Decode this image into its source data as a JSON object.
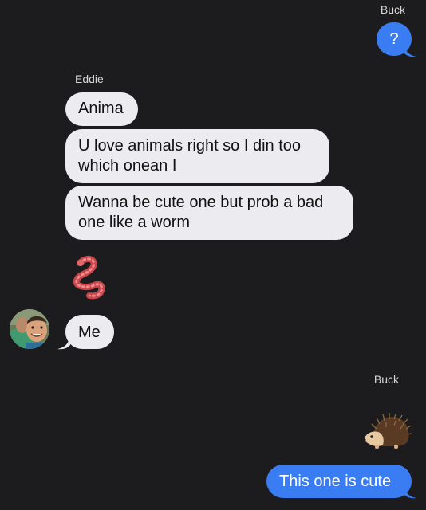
{
  "conversation": {
    "buck_label_top": "Buck",
    "buck_msg_1": "?",
    "eddie_label": "Eddie",
    "eddie_msg_1": "Anima",
    "eddie_msg_2_line_1": "U love animals right so I din too",
    "eddie_msg_2_line_2": "which onean I",
    "eddie_msg_3_line_1": "Wanna be cute one but prob a bad",
    "eddie_msg_3_line_2": "one like a worm",
    "eddie_emoji": "worm",
    "eddie_msg_4": "Me",
    "buck_label_bottom": "Buck",
    "buck_emoji": "hedgehog",
    "buck_msg_2": "This one is cute"
  },
  "colors": {
    "background": "#1c1c1e",
    "incoming_bubble": "#ececf0",
    "outgoing_bubble": "#3a7cf2",
    "sender_label": "#d6d6d8"
  }
}
